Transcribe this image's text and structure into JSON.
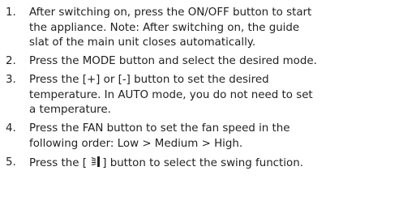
{
  "steps": [
    {
      "number": "1.",
      "lines": [
        "After switching on, press the ON/OFF button to start",
        "the appliance. Note: After switching on, the guide",
        "slat of the main unit closes automatically."
      ]
    },
    {
      "number": "2.",
      "lines": [
        "Press the MODE button and select the desired mode."
      ]
    },
    {
      "number": "3.",
      "lines": [
        "Press the [+] or [-] button to set the desired",
        "temperature. In AUTO mode, you do not need to set",
        "a  temperature."
      ]
    },
    {
      "number": "4.",
      "lines": [
        "Press the FAN button to set the fan speed in the",
        "following order: Low > Medium > High."
      ]
    },
    {
      "number": "5.",
      "line_before_icon": "Press the [ ",
      "icon": "swing-icon",
      "line_after_icon": "] button to select the swing function."
    }
  ]
}
